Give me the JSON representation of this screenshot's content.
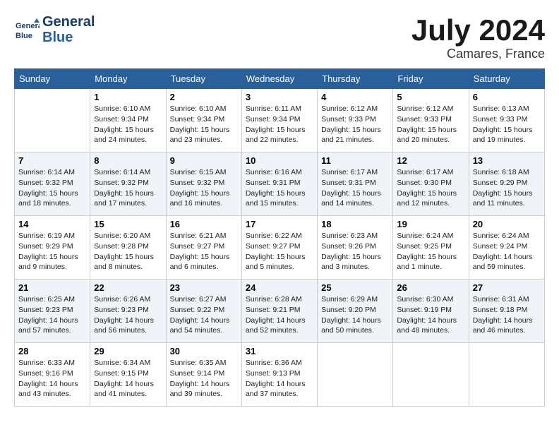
{
  "logo": {
    "name": "General",
    "name2": "Blue"
  },
  "title": "July 2024",
  "location": "Camares, France",
  "days_of_week": [
    "Sunday",
    "Monday",
    "Tuesday",
    "Wednesday",
    "Thursday",
    "Friday",
    "Saturday"
  ],
  "weeks": [
    [
      {
        "day": "",
        "info": ""
      },
      {
        "day": "1",
        "info": "Sunrise: 6:10 AM\nSunset: 9:34 PM\nDaylight: 15 hours\nand 24 minutes."
      },
      {
        "day": "2",
        "info": "Sunrise: 6:10 AM\nSunset: 9:34 PM\nDaylight: 15 hours\nand 23 minutes."
      },
      {
        "day": "3",
        "info": "Sunrise: 6:11 AM\nSunset: 9:34 PM\nDaylight: 15 hours\nand 22 minutes."
      },
      {
        "day": "4",
        "info": "Sunrise: 6:12 AM\nSunset: 9:33 PM\nDaylight: 15 hours\nand 21 minutes."
      },
      {
        "day": "5",
        "info": "Sunrise: 6:12 AM\nSunset: 9:33 PM\nDaylight: 15 hours\nand 20 minutes."
      },
      {
        "day": "6",
        "info": "Sunrise: 6:13 AM\nSunset: 9:33 PM\nDaylight: 15 hours\nand 19 minutes."
      }
    ],
    [
      {
        "day": "7",
        "info": "Sunrise: 6:14 AM\nSunset: 9:32 PM\nDaylight: 15 hours\nand 18 minutes."
      },
      {
        "day": "8",
        "info": "Sunrise: 6:14 AM\nSunset: 9:32 PM\nDaylight: 15 hours\nand 17 minutes."
      },
      {
        "day": "9",
        "info": "Sunrise: 6:15 AM\nSunset: 9:32 PM\nDaylight: 15 hours\nand 16 minutes."
      },
      {
        "day": "10",
        "info": "Sunrise: 6:16 AM\nSunset: 9:31 PM\nDaylight: 15 hours\nand 15 minutes."
      },
      {
        "day": "11",
        "info": "Sunrise: 6:17 AM\nSunset: 9:31 PM\nDaylight: 15 hours\nand 14 minutes."
      },
      {
        "day": "12",
        "info": "Sunrise: 6:17 AM\nSunset: 9:30 PM\nDaylight: 15 hours\nand 12 minutes."
      },
      {
        "day": "13",
        "info": "Sunrise: 6:18 AM\nSunset: 9:29 PM\nDaylight: 15 hours\nand 11 minutes."
      }
    ],
    [
      {
        "day": "14",
        "info": "Sunrise: 6:19 AM\nSunset: 9:29 PM\nDaylight: 15 hours\nand 9 minutes."
      },
      {
        "day": "15",
        "info": "Sunrise: 6:20 AM\nSunset: 9:28 PM\nDaylight: 15 hours\nand 8 minutes."
      },
      {
        "day": "16",
        "info": "Sunrise: 6:21 AM\nSunset: 9:27 PM\nDaylight: 15 hours\nand 6 minutes."
      },
      {
        "day": "17",
        "info": "Sunrise: 6:22 AM\nSunset: 9:27 PM\nDaylight: 15 hours\nand 5 minutes."
      },
      {
        "day": "18",
        "info": "Sunrise: 6:23 AM\nSunset: 9:26 PM\nDaylight: 15 hours\nand 3 minutes."
      },
      {
        "day": "19",
        "info": "Sunrise: 6:24 AM\nSunset: 9:25 PM\nDaylight: 15 hours\nand 1 minute."
      },
      {
        "day": "20",
        "info": "Sunrise: 6:24 AM\nSunset: 9:24 PM\nDaylight: 14 hours\nand 59 minutes."
      }
    ],
    [
      {
        "day": "21",
        "info": "Sunrise: 6:25 AM\nSunset: 9:23 PM\nDaylight: 14 hours\nand 57 minutes."
      },
      {
        "day": "22",
        "info": "Sunrise: 6:26 AM\nSunset: 9:23 PM\nDaylight: 14 hours\nand 56 minutes."
      },
      {
        "day": "23",
        "info": "Sunrise: 6:27 AM\nSunset: 9:22 PM\nDaylight: 14 hours\nand 54 minutes."
      },
      {
        "day": "24",
        "info": "Sunrise: 6:28 AM\nSunset: 9:21 PM\nDaylight: 14 hours\nand 52 minutes."
      },
      {
        "day": "25",
        "info": "Sunrise: 6:29 AM\nSunset: 9:20 PM\nDaylight: 14 hours\nand 50 minutes."
      },
      {
        "day": "26",
        "info": "Sunrise: 6:30 AM\nSunset: 9:19 PM\nDaylight: 14 hours\nand 48 minutes."
      },
      {
        "day": "27",
        "info": "Sunrise: 6:31 AM\nSunset: 9:18 PM\nDaylight: 14 hours\nand 46 minutes."
      }
    ],
    [
      {
        "day": "28",
        "info": "Sunrise: 6:33 AM\nSunset: 9:16 PM\nDaylight: 14 hours\nand 43 minutes."
      },
      {
        "day": "29",
        "info": "Sunrise: 6:34 AM\nSunset: 9:15 PM\nDaylight: 14 hours\nand 41 minutes."
      },
      {
        "day": "30",
        "info": "Sunrise: 6:35 AM\nSunset: 9:14 PM\nDaylight: 14 hours\nand 39 minutes."
      },
      {
        "day": "31",
        "info": "Sunrise: 6:36 AM\nSunset: 9:13 PM\nDaylight: 14 hours\nand 37 minutes."
      },
      {
        "day": "",
        "info": ""
      },
      {
        "day": "",
        "info": ""
      },
      {
        "day": "",
        "info": ""
      }
    ]
  ]
}
